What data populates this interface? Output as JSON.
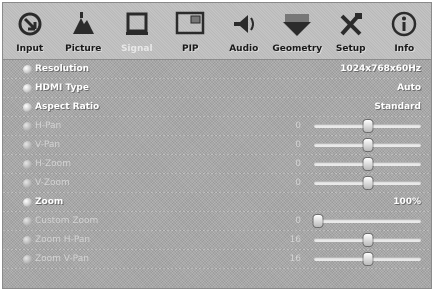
{
  "tabs": [
    {
      "name": "input",
      "label": "Input",
      "icon": "input-icon",
      "active": false
    },
    {
      "name": "picture",
      "label": "Picture",
      "icon": "picture-icon",
      "active": false
    },
    {
      "name": "signal",
      "label": "Signal",
      "icon": "signal-icon",
      "active": true
    },
    {
      "name": "pip",
      "label": "PIP",
      "icon": "pip-icon",
      "active": false
    },
    {
      "name": "audio",
      "label": "Audio",
      "icon": "speaker-icon",
      "active": false
    },
    {
      "name": "geometry",
      "label": "Geometry",
      "icon": "geometry-icon",
      "active": false
    },
    {
      "name": "setup",
      "label": "Setup",
      "icon": "tools-icon",
      "active": false
    },
    {
      "name": "info",
      "label": "Info",
      "icon": "info-icon",
      "active": false
    }
  ],
  "rows": [
    {
      "label": "Resolution",
      "value": "1024x768x60Hz",
      "dim": false
    },
    {
      "label": "HDMI Type",
      "value": "Auto",
      "dim": false
    },
    {
      "label": "Aspect Ratio",
      "value": "Standard",
      "dim": false
    },
    {
      "label": "H-Pan",
      "number": "0",
      "level": 0.5,
      "dim": true
    },
    {
      "label": "V-Pan",
      "number": "0",
      "level": 0.5,
      "dim": true
    },
    {
      "label": "H-Zoom",
      "number": "0",
      "level": 0.5,
      "dim": true
    },
    {
      "label": "V-Zoom",
      "number": "0",
      "level": 0.5,
      "dim": true
    },
    {
      "label": "Zoom",
      "value": "100%",
      "dim": false
    },
    {
      "label": "Custom Zoom",
      "number": "0",
      "level": 0.04,
      "dim": true
    },
    {
      "label": "Zoom H-Pan",
      "number": "16",
      "level": 0.5,
      "dim": true
    },
    {
      "label": "Zoom V-Pan",
      "number": "16",
      "level": 0.5,
      "dim": true
    }
  ]
}
